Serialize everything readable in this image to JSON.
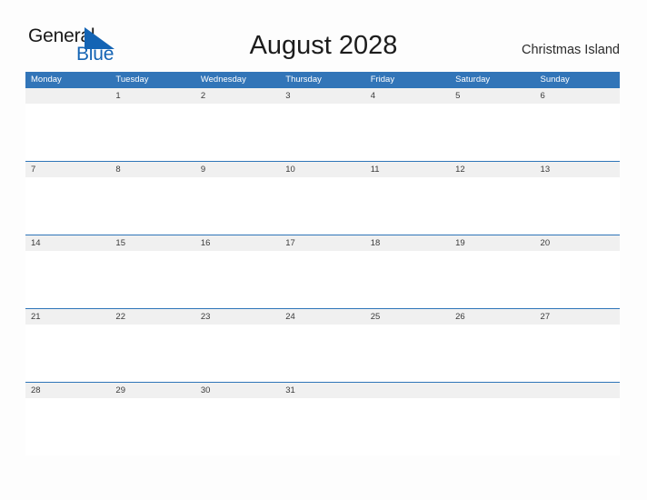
{
  "logo": {
    "word_one": "General",
    "word_two": "Blue",
    "triangle_icon": "blue-triangle-icon",
    "triangle_color": "#1464b4",
    "word_one_color": "#1a1a1a",
    "word_two_color": "#1464b4"
  },
  "header": {
    "title": "August 2028",
    "location": "Christmas Island"
  },
  "colors": {
    "header_blue": "#3275b8",
    "row_rule_blue": "#2e75b8",
    "date_band_gray": "#f0f0f0",
    "page_background": "#fdfdfd",
    "weekday_text": "#ffffff",
    "date_text": "#3a3a3a"
  },
  "calendar": {
    "month": "August",
    "year": "2028",
    "weekday_headers": [
      "Monday",
      "Tuesday",
      "Wednesday",
      "Thursday",
      "Friday",
      "Saturday",
      "Sunday"
    ],
    "weeks": [
      [
        "",
        "1",
        "2",
        "3",
        "4",
        "5",
        "6"
      ],
      [
        "7",
        "8",
        "9",
        "10",
        "11",
        "12",
        "13"
      ],
      [
        "14",
        "15",
        "16",
        "17",
        "18",
        "19",
        "20"
      ],
      [
        "21",
        "22",
        "23",
        "24",
        "25",
        "26",
        "27"
      ],
      [
        "28",
        "29",
        "30",
        "31",
        "",
        "",
        ""
      ]
    ]
  }
}
